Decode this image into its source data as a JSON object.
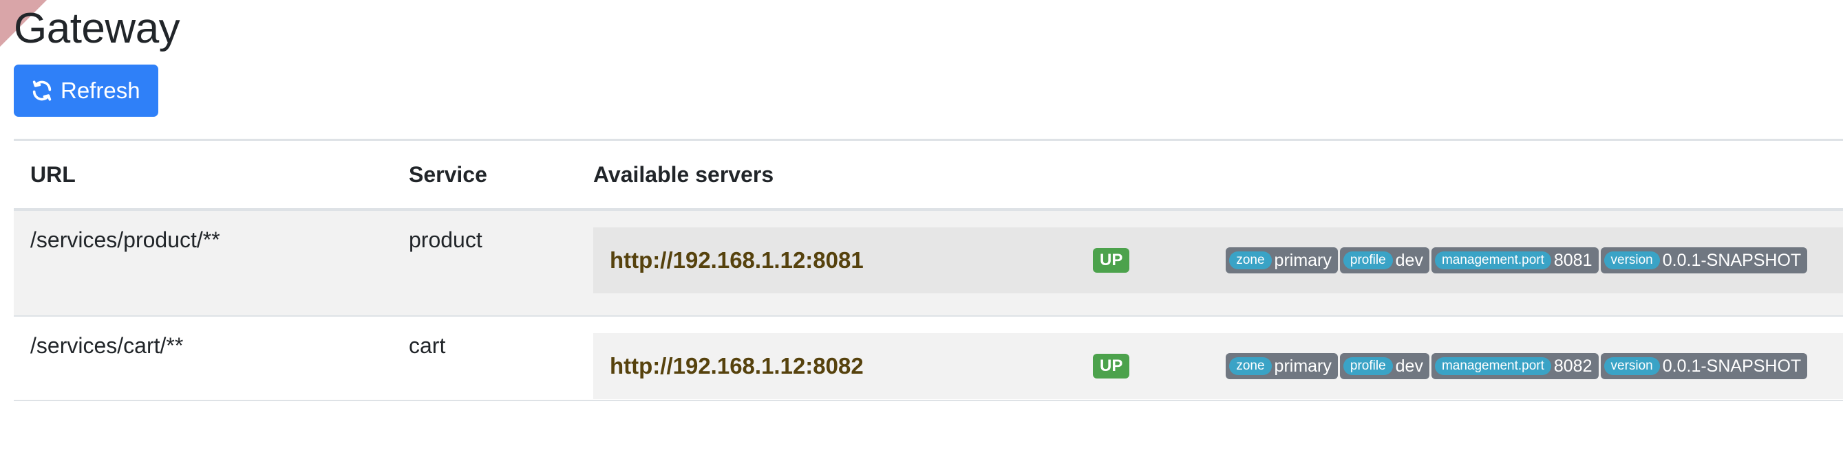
{
  "page": {
    "title": "Gateway",
    "refresh_label": "Refresh"
  },
  "table": {
    "headers": [
      "URL",
      "Service",
      "Available servers"
    ],
    "routes": [
      {
        "url": "/services/product/**",
        "service": "product",
        "servers": [
          {
            "address": "http://192.168.1.12:8081",
            "status": "UP",
            "metadata": [
              {
                "key": "zone",
                "value": "primary"
              },
              {
                "key": "profile",
                "value": "dev"
              },
              {
                "key": "management.port",
                "value": "8081"
              },
              {
                "key": "version",
                "value": "0.0.1-SNAPSHOT"
              }
            ]
          }
        ]
      },
      {
        "url": "/services/cart/**",
        "service": "cart",
        "servers": [
          {
            "address": "http://192.168.1.12:8082",
            "status": "UP",
            "metadata": [
              {
                "key": "zone",
                "value": "primary"
              },
              {
                "key": "profile",
                "value": "dev"
              },
              {
                "key": "management.port",
                "value": "8082"
              },
              {
                "key": "version",
                "value": "0.0.1-SNAPSHOT"
              }
            ]
          }
        ]
      }
    ]
  },
  "colors": {
    "primary_button": "#2f80f8",
    "status_up": "#4ca24c",
    "link": "#56420d",
    "meta_tag_bg": "#707781",
    "meta_key_bg": "#3aa3c6",
    "corner_ribbon": "#d9a5a8"
  },
  "icons": {
    "refresh": "refresh-icon"
  }
}
